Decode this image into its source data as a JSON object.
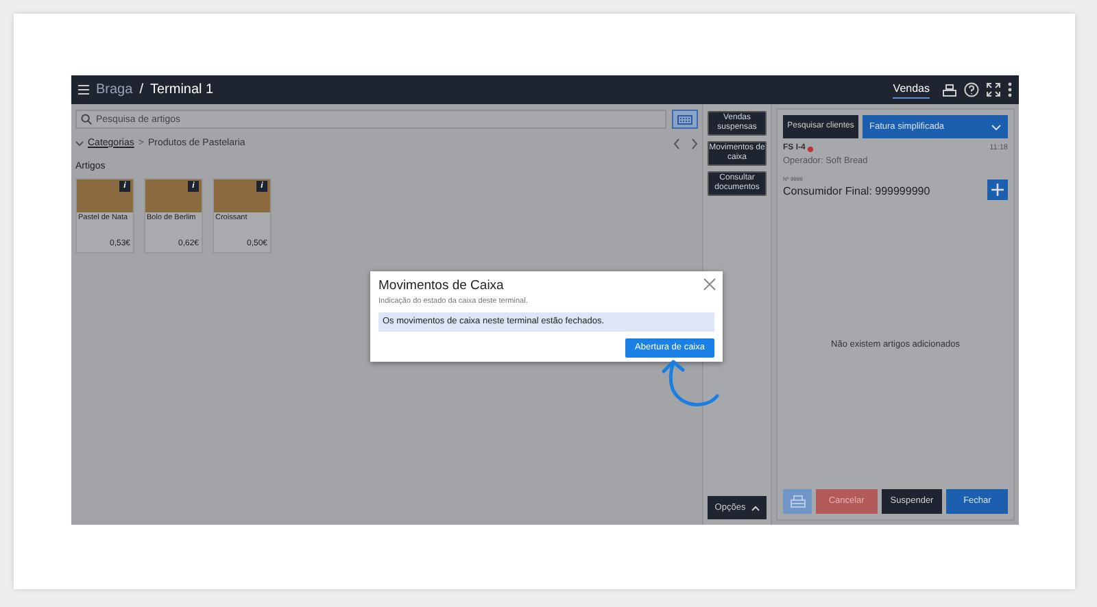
{
  "header": {
    "location": "Braga",
    "separator": "/",
    "terminal": "Terminal 1",
    "nav_tab": {
      "label": "Vendas",
      "selected": true
    }
  },
  "search": {
    "placeholder": "Pesquisa de artigos"
  },
  "breadcrumb": {
    "root": "Categorias",
    "separator": ">",
    "current": "Produtos de Pastelaria"
  },
  "articles": {
    "title": "Artigos",
    "items": [
      {
        "name": "Pastel de Nata",
        "price": "0,53€",
        "info": "i"
      },
      {
        "name": "Bolo de Berlim",
        "price": "0,62€",
        "info": "i"
      },
      {
        "name": "Croissant",
        "price": "0,50€",
        "info": "i"
      }
    ]
  },
  "side_buttons": [
    "Vendas suspensas",
    "Movimentos de caixa",
    "Consultar documentos"
  ],
  "options_button": "Opções",
  "document": {
    "search_clients": "Pesquisar clientes",
    "doc_type": "Fatura simplificada",
    "doc_number": "FS I-4",
    "time": "11:18",
    "operator": "Operador: Soft Bread",
    "nif_label": "Nº 9999",
    "customer": "Consumidor Final: 999999990",
    "empty_message": "Não existem artigos adicionados"
  },
  "footer_buttons": [
    "Cancelar",
    "Suspender",
    "Fechar"
  ],
  "modal": {
    "title": "Movimentos de Caixa",
    "subtitle": "Indicação do estado da caixa deste terminal.",
    "message": "Os movimentos de caixa neste terminal estão fechados.",
    "action": "Abertura de caixa"
  }
}
